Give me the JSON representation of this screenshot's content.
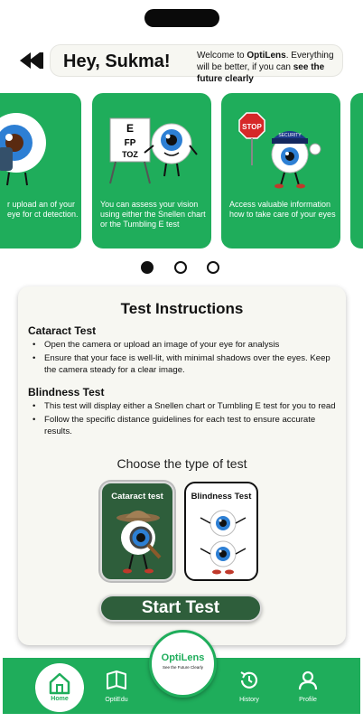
{
  "header": {
    "greeting_prefix": "Hey, ",
    "user_name": "Sukma!",
    "welcome_prefix": "Welcome to ",
    "brand": "OptiLens",
    "welcome_middle": ". Everything will be better, if you can ",
    "welcome_bold": "see the future clearly"
  },
  "carousel": {
    "cards": [
      {
        "text": "r upload an of your eye for ct detection.",
        "icon": "eyeball-with-camera"
      },
      {
        "text": "You can assess your vision using either the Snellen chart or the Tumbling E test",
        "icon": "eyeball-with-snellen-chart",
        "chart_letters": [
          "E",
          "FP",
          "TOZ"
        ]
      },
      {
        "text": "Access valuable information how to take care of your eyes",
        "icon": "eyeball-security-guard",
        "stop_text": "STOP",
        "cap_text": "SECURITY"
      }
    ],
    "active_index": 0,
    "dot_count": 3
  },
  "instructions": {
    "title": "Test Instructions",
    "cataract_title": "Cataract Test",
    "cataract_bullets": [
      "Open the camera or upload an image of your eye for analysis",
      "Ensure that your face is well-lit, with minimal shadows over the eyes. Keep the camera steady for a clear image."
    ],
    "blind_title": "Blindness Test",
    "blind_bullets": [
      "This test will display either a Snellen chart or Tumbling E test for you to read",
      "Follow the specific distance guidelines for each test to ensure accurate results."
    ],
    "choose_label": "Choose the type of test",
    "cataract_option": "Cataract test",
    "blind_option": "Blindness Test",
    "start_label": "Start Test"
  },
  "tabbar": {
    "home": "Home",
    "optiedu": "OptiEdu",
    "history": "History",
    "profile": "Profile",
    "logo_name": "OptiLens",
    "logo_tagline": "See the Future Clearly"
  },
  "colors": {
    "brand_green": "#1fad5b",
    "dark_green": "#2e5e3b",
    "panel_bg": "#f7f7f2"
  }
}
